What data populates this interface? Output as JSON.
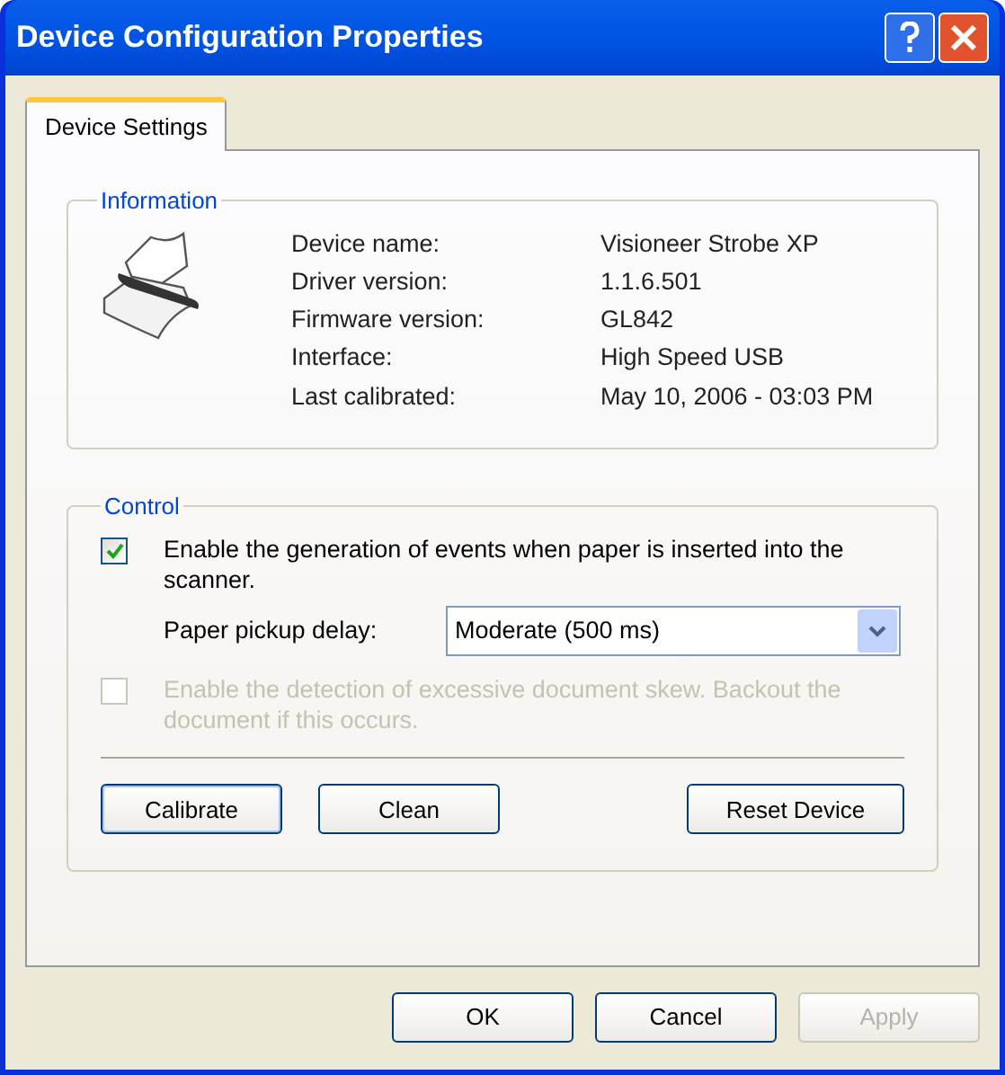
{
  "window": {
    "title": "Device Configuration Properties"
  },
  "tabs": [
    {
      "label": "Device Settings",
      "selected": true
    }
  ],
  "information": {
    "label": "Information",
    "rows": [
      {
        "name": "Device name:",
        "value": "Visioneer Strobe XP"
      },
      {
        "name": "Driver version:",
        "value": "1.1.6.501"
      },
      {
        "name": "Firmware version:",
        "value": "GL842"
      },
      {
        "name": "Interface:",
        "value": "High Speed USB"
      },
      {
        "name": "Last calibrated:",
        "value": "May 10, 2006 - 03:03 PM"
      }
    ]
  },
  "control": {
    "label": "Control",
    "checkboxes": [
      {
        "label": "Enable the generation of events when paper is inserted into the scanner.",
        "checked": true,
        "disabled": false
      },
      {
        "label": "Enable the detection of excessive document skew. Backout the document if this occurs.",
        "checked": false,
        "disabled": true
      }
    ],
    "delay": {
      "label": "Paper pickup delay:",
      "value": "Moderate (500 ms)"
    },
    "buttons": [
      {
        "label": "Calibrate",
        "default": true
      },
      {
        "label": "Clean",
        "default": false
      },
      {
        "label": "Reset Device",
        "default": false
      }
    ]
  },
  "footer_buttons": [
    {
      "label": "OK",
      "disabled": false
    },
    {
      "label": "Cancel",
      "disabled": false
    },
    {
      "label": "Apply",
      "disabled": true
    }
  ]
}
